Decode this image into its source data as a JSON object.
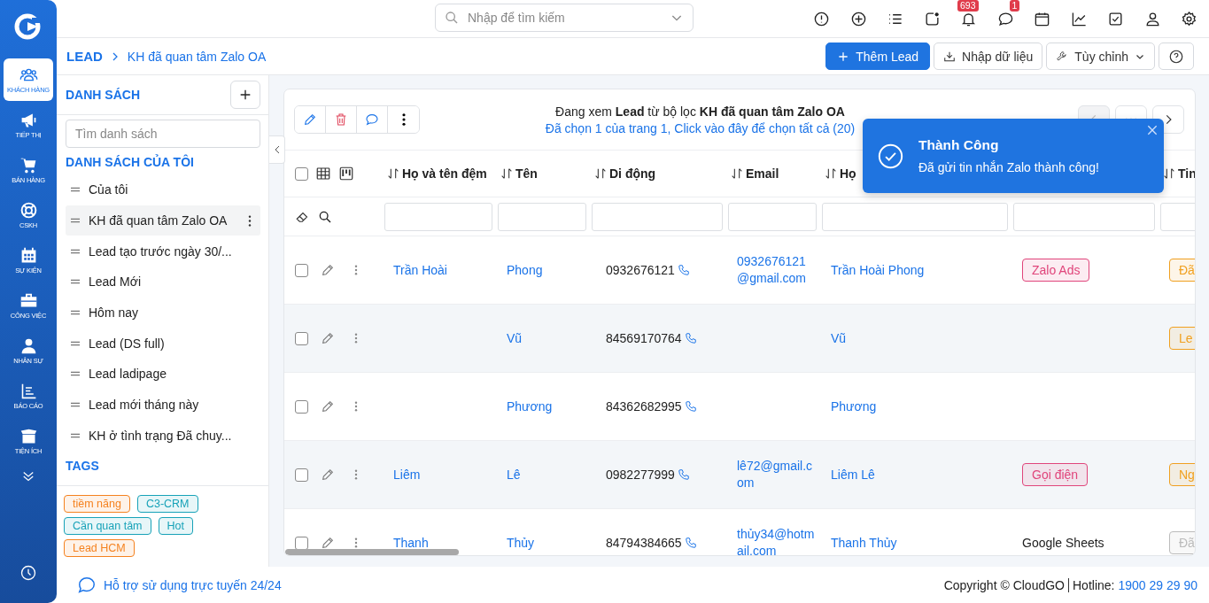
{
  "rail": {
    "items": [
      {
        "label": "KHÁCH HÀNG",
        "selected": true
      },
      {
        "label": "TIẾP THỊ",
        "selected": false
      },
      {
        "label": "BÁN HÀNG",
        "selected": false
      },
      {
        "label": "CSKH",
        "selected": false
      },
      {
        "label": "SỰ KIỆN",
        "selected": false
      },
      {
        "label": "CÔNG VIỆC",
        "selected": false
      },
      {
        "label": "NHÂN SỰ",
        "selected": false
      },
      {
        "label": "BÁO CÁO",
        "selected": false
      },
      {
        "label": "TIỆN ÍCH",
        "selected": false
      }
    ]
  },
  "topbar": {
    "search_placeholder": "Nhập để tìm kiếm",
    "notification_count": "693",
    "message_count": "1"
  },
  "breadcrumb": {
    "root": "LEAD",
    "current": "KH đã quan tâm Zalo OA"
  },
  "actions": [
    {
      "label": "Thêm Lead",
      "kind": "primary"
    },
    {
      "label": "Nhập dữ liệu",
      "kind": "import"
    },
    {
      "label": "Tùy chỉnh",
      "kind": "dropdown"
    }
  ],
  "list_panel": {
    "title": "DANH SÁCH",
    "search_placeholder": "Tìm danh sách",
    "section_title": "DANH SÁCH CỦA TÔI",
    "items": [
      {
        "label": "Của tôi",
        "selected": false
      },
      {
        "label": "KH đã quan tâm Zalo OA",
        "selected": true
      },
      {
        "label": "Lead tạo trước ngày 30/...",
        "selected": false
      },
      {
        "label": "Lead Mới",
        "selected": false
      },
      {
        "label": "Hôm nay",
        "selected": false
      },
      {
        "label": "Lead (DS full)",
        "selected": false
      },
      {
        "label": "Lead ladipage",
        "selected": false
      },
      {
        "label": "Lead mới tháng này",
        "selected": false
      },
      {
        "label": "KH ở tình trạng Đã chuy...",
        "selected": false
      }
    ],
    "tags_title": "TAGS",
    "tags": [
      {
        "label": "tiềm năng",
        "color": "#f5821f"
      },
      {
        "label": "C3-CRM",
        "color": "#17a2b8"
      },
      {
        "label": "Cần quan tâm",
        "color": "#17a2b8"
      },
      {
        "label": "Hot",
        "color": "#17a2b8"
      },
      {
        "label": "Lead HCM",
        "color": "#f5821f"
      }
    ]
  },
  "toolbar": {
    "summary": "Đang xem **Lead** từ bộ lọc **KH đã quan tâm Zalo OA**",
    "selection_link": "Đã chọn 1 của trang 1, Click vào đây để chọn tất cả (20)",
    "prev_disabled": true
  },
  "table": {
    "all_selected": false,
    "columns": [
      {
        "label": "Họ và tên đệm"
      },
      {
        "label": "Tên"
      },
      {
        "label": "Di động"
      },
      {
        "label": "Email"
      },
      {
        "label": "Họ"
      },
      {},
      {
        "label": "Tin"
      }
    ],
    "rows": [
      {
        "checked": false,
        "cells": [
          {
            "kind": "link",
            "text": "Trần Hoài"
          },
          {
            "kind": "link",
            "text": "Phong"
          },
          {
            "kind": "phone",
            "text": "0932676121"
          },
          {
            "kind": "link",
            "text": "0932676121@gmail.com"
          },
          {
            "kind": "link",
            "text": "Trần Hoài Phong"
          },
          {
            "kind": "tag",
            "text": "Zalo Ads",
            "color": "#e0457b"
          },
          {
            "kind": "tag",
            "text": "Đã",
            "color": "#f0a020"
          }
        ]
      },
      {
        "checked": false,
        "cells": [
          {
            "kind": "empty"
          },
          {
            "kind": "link",
            "text": "Vũ"
          },
          {
            "kind": "phone",
            "text": "84569170764"
          },
          {
            "kind": "empty"
          },
          {
            "kind": "link",
            "text": "Vũ"
          },
          {
            "kind": "empty"
          },
          {
            "kind": "tag",
            "text": "Le",
            "color": "#f0a020"
          }
        ]
      },
      {
        "checked": false,
        "cells": [
          {
            "kind": "empty"
          },
          {
            "kind": "link",
            "text": "Phương"
          },
          {
            "kind": "phone",
            "text": "84362682995"
          },
          {
            "kind": "empty"
          },
          {
            "kind": "link",
            "text": "Phương"
          },
          {
            "kind": "empty"
          },
          {
            "kind": "empty"
          }
        ]
      },
      {
        "checked": false,
        "cells": [
          {
            "kind": "link",
            "text": "Liêm"
          },
          {
            "kind": "link",
            "text": "Lê"
          },
          {
            "kind": "phone",
            "text": "0982277999"
          },
          {
            "kind": "link",
            "text": "lê72@gmail.com"
          },
          {
            "kind": "link",
            "text": "Liêm Lê"
          },
          {
            "kind": "tag",
            "text": "Gọi điện",
            "color": "#e0457b"
          },
          {
            "kind": "tag",
            "text": "Ng",
            "color": "#f0a020"
          }
        ]
      },
      {
        "checked": false,
        "cells": [
          {
            "kind": "link",
            "text": "Thanh"
          },
          {
            "kind": "link",
            "text": "Thủy"
          },
          {
            "kind": "phone",
            "text": "84794384665"
          },
          {
            "kind": "link",
            "text": "thủy34@hotmail.com"
          },
          {
            "kind": "link",
            "text": "Thanh Thủy"
          },
          {
            "kind": "plain",
            "text": "Google Sheets"
          },
          {
            "kind": "tag",
            "text": "Đã",
            "color": "#bbbbbb"
          }
        ]
      }
    ]
  },
  "toast": {
    "title": "Thành Công",
    "message": "Đã gửi tin nhắn Zalo thành công!"
  },
  "footer": {
    "support": "Hỗ trợ sử dụng trực tuyến 24/24",
    "copyright": "Copyright © CloudGO",
    "hotline_label": "Hotline:",
    "hotline": "1900 29 29 90"
  }
}
